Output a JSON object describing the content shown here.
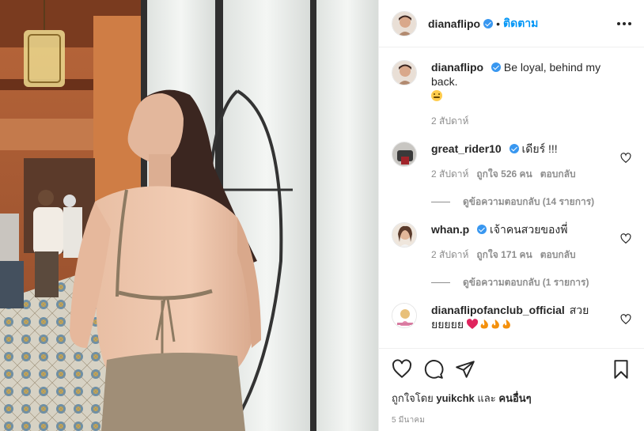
{
  "header": {
    "username": "dianaflipo",
    "separator": "•",
    "follow_label": "ติดตาม"
  },
  "caption": {
    "username": "dianaflipo",
    "text": "Be loyal, behind my back.",
    "emoji": "grimace-smile-emoji",
    "age": "2 สัปดาห์"
  },
  "comments": [
    {
      "username": "great_rider10",
      "verified": true,
      "text": "เดียร์ !!!",
      "age": "2 สัปดาห์",
      "likes": "ถูกใจ 526 คน",
      "reply_label": "ตอบกลับ",
      "view_replies": "ดูข้อความตอบกลับ (14 รายการ)"
    },
    {
      "username": "whan.p",
      "verified": true,
      "text": "เจ้าคนสวยของพี่",
      "age": "2 สัปดาห์",
      "likes": "ถูกใจ 171 คน",
      "reply_label": "ตอบกลับ",
      "view_replies": "ดูข้อความตอบกลับ (1 รายการ)"
    },
    {
      "username": "dianaflipofanclub_official",
      "verified": false,
      "text": "สวยยยยยย",
      "emoji": "red-heart-and-three-fire-emoji",
      "age": "",
      "likes": "",
      "reply_label": ""
    }
  ],
  "likes": {
    "prefix": "ถูกใจโดย",
    "user": "yuikchk",
    "conj": "และ",
    "others": "คนอื่นๆ"
  },
  "post_date": "5 มีนาคม",
  "icons": {
    "more": "more-horizontal-icon",
    "like": "heart-outline-icon",
    "comment": "comment-bubble-icon",
    "share": "paper-plane-icon",
    "save": "bookmark-icon"
  },
  "colors": {
    "accent": "#0095f6",
    "verified": "#3897f0",
    "muted": "#8e8e8e",
    "heart_emoji": "#e0245e",
    "fire_emoji": "#f4900c"
  }
}
